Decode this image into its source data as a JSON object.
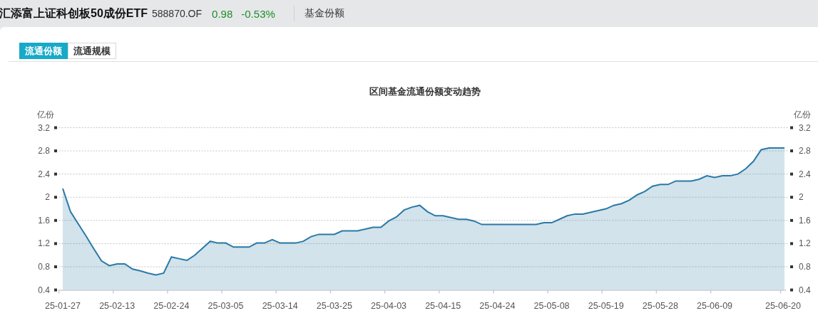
{
  "header": {
    "fund_name": "汇添富上证科创板50成份ETF",
    "code": "588870.OF",
    "price": "0.98",
    "change": "-0.53%",
    "section": "基金份额"
  },
  "tabs": [
    {
      "label": "流通份额",
      "selected": true
    },
    {
      "label": "流通规模",
      "selected": false
    }
  ],
  "chart": {
    "right_axis": {
      "unit": "亿份",
      "ticks": [
        "3.2",
        "2.8",
        "2.4",
        "2",
        "1.6",
        "1.2",
        "0.8",
        "0.4"
      ]
    },
    "chart_data": {
      "type": "area",
      "title": "区间基金流通份额变动趋势",
      "ylabel": "亿份",
      "categories": [
        "25-01-27",
        null,
        null,
        null,
        null,
        null,
        null,
        "25-02-13",
        null,
        null,
        null,
        null,
        null,
        null,
        "25-02-24",
        null,
        null,
        null,
        null,
        null,
        null,
        "25-03-05",
        null,
        null,
        null,
        null,
        null,
        null,
        "25-03-14",
        null,
        null,
        null,
        null,
        null,
        null,
        "25-03-25",
        null,
        null,
        null,
        null,
        null,
        null,
        "25-04-03",
        null,
        null,
        null,
        null,
        null,
        null,
        "25-04-15",
        null,
        null,
        null,
        null,
        null,
        null,
        "25-04-24",
        null,
        null,
        null,
        null,
        null,
        null,
        "25-05-08",
        null,
        null,
        null,
        null,
        null,
        null,
        "25-05-19",
        null,
        null,
        null,
        null,
        null,
        null,
        "25-05-28",
        null,
        null,
        null,
        null,
        null,
        null,
        "25-06-09",
        null,
        null,
        null,
        null,
        null,
        null,
        null,
        null,
        "25-06-20"
      ],
      "series": [
        {
          "color": "#2a79a6",
          "values": [
            2.15,
            1.75,
            1.54,
            1.33,
            1.11,
            0.9,
            0.82,
            0.85,
            0.85,
            0.76,
            0.73,
            0.69,
            0.66,
            0.69,
            0.97,
            0.94,
            0.91,
            1.0,
            1.12,
            1.24,
            1.21,
            1.21,
            1.14,
            1.14,
            1.14,
            1.21,
            1.21,
            1.27,
            1.21,
            1.21,
            1.21,
            1.24,
            1.32,
            1.36,
            1.36,
            1.36,
            1.42,
            1.42,
            1.42,
            1.45,
            1.48,
            1.48,
            1.59,
            1.66,
            1.78,
            1.83,
            1.86,
            1.75,
            1.68,
            1.68,
            1.65,
            1.62,
            1.62,
            1.59,
            1.53,
            1.53,
            1.53,
            1.53,
            1.53,
            1.53,
            1.53,
            1.53,
            1.56,
            1.56,
            1.62,
            1.68,
            1.71,
            1.71,
            1.74,
            1.77,
            1.8,
            1.86,
            1.89,
            1.95,
            2.04,
            2.1,
            2.19,
            2.22,
            2.22,
            2.28,
            2.28,
            2.28,
            2.31,
            2.37,
            2.34,
            2.37,
            2.37,
            2.4,
            2.49,
            2.62,
            2.82,
            2.85,
            2.85,
            2.85
          ]
        }
      ],
      "ylim": [
        0.4,
        3.2
      ],
      "grid": true,
      "yticks": [
        0.4,
        0.8,
        1.2,
        1.6,
        2,
        2.4,
        2.8,
        3.2
      ]
    }
  }
}
